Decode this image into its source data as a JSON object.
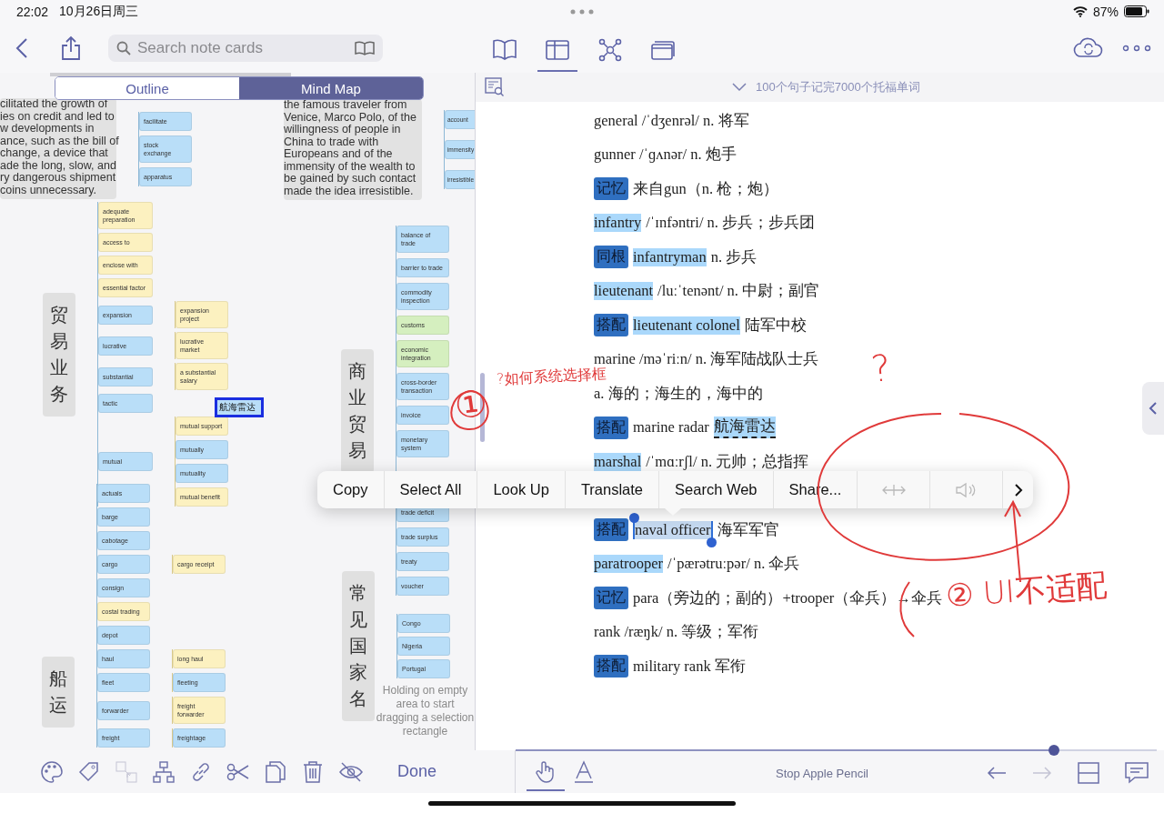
{
  "status_bar": {
    "time": "22:02",
    "date": "10月26日周三",
    "battery": "87%"
  },
  "toolbar": {
    "search": {
      "placeholder": "Search note cards"
    },
    "view_tabs": [
      {
        "kind": "book",
        "selected": false
      },
      {
        "kind": "panel",
        "selected": true
      },
      {
        "kind": "mindmap",
        "selected": false
      },
      {
        "kind": "cards",
        "selected": false
      }
    ]
  },
  "left_panel": {
    "segments": [
      {
        "label": "Outline",
        "selected": false
      },
      {
        "label": "Mind Map",
        "selected": true
      }
    ],
    "clusters": [
      {
        "kind": "note",
        "text": "cilitated the growth of\nies on credit and led to\nw developments in\nance, such as the bill of\nchange, a device that\nade the long, slow, and\nry dangerous shipment\ncoins unnecessary.",
        "children": [
          {
            "label": "facilitate",
            "color": "#b9def8"
          },
          {
            "label": "stock exchange",
            "color": "#b9def8"
          },
          {
            "label": "apparatus",
            "color": "#b9def8"
          }
        ]
      },
      {
        "kind": "topic",
        "title": "贸易业务",
        "children": [
          {
            "label": "adequate preparation",
            "color": "#fcf1c0"
          },
          {
            "label": "access to",
            "color": "#fcf1c0"
          },
          {
            "label": "enclose with",
            "color": "#fcf1c0"
          },
          {
            "label": "essential factor",
            "color": "#fcf1c0"
          },
          {
            "label": "expansion",
            "color": "#b9def8",
            "children": [
              {
                "label": "expansion project",
                "color": "#fcf1c0"
              }
            ]
          },
          {
            "label": "lucrative",
            "color": "#b9def8",
            "children": [
              {
                "label": "lucrative market",
                "color": "#fcf1c0"
              }
            ]
          },
          {
            "label": "substantial",
            "color": "#b9def8",
            "children": [
              {
                "label": "a substantial salary",
                "color": "#fcf1c0"
              }
            ]
          },
          {
            "label": "tactic",
            "color": "#b9def8"
          },
          {
            "label": "mutual",
            "color": "#b9def8",
            "children": [
              {
                "label": "mutual support",
                "color": "#fcf1c0"
              },
              {
                "label": "mutually",
                "color": "#b9def8"
              },
              {
                "label": "mutuality",
                "color": "#b9def8"
              },
              {
                "label": "mutual benefit",
                "color": "#fcf1c0"
              }
            ]
          }
        ]
      },
      {
        "kind": "topic",
        "title": "船运",
        "children": [
          {
            "label": "actuals",
            "color": "#b9def8"
          },
          {
            "label": "barge",
            "color": "#b9def8"
          },
          {
            "label": "cabotage",
            "color": "#b9def8"
          },
          {
            "label": "cargo",
            "color": "#b9def8",
            "children": [
              {
                "label": "cargo receipt",
                "color": "#fcf1c0"
              }
            ]
          },
          {
            "label": "consign",
            "color": "#b9def8"
          },
          {
            "label": "costal trading",
            "color": "#fcf1c0"
          },
          {
            "label": "depot",
            "color": "#b9def8"
          },
          {
            "label": "haul",
            "color": "#b9def8",
            "children": [
              {
                "label": "long haul",
                "color": "#fcf1c0"
              }
            ]
          },
          {
            "label": "fleet",
            "color": "#b9def8",
            "children": [
              {
                "label": "fleeting",
                "color": "#b9def8"
              }
            ]
          },
          {
            "label": "forwarder",
            "color": "#b9def8",
            "children": [
              {
                "label": "freight forwarder",
                "color": "#fcf1c0"
              }
            ]
          },
          {
            "label": "freight",
            "color": "#b9def8",
            "children": [
              {
                "label": "freightage",
                "color": "#b9def8"
              }
            ]
          }
        ]
      },
      {
        "kind": "note",
        "text": "the famous traveler from\nVenice, Marco Polo, of the\nwillingness of people in\nChina to trade with\nEuropeans and of the\nimmensity of the wealth to\nbe gained by such contact\nmade the idea irresistible.",
        "children": [
          {
            "label": "account",
            "color": "#b9def8"
          },
          {
            "label": "immensity",
            "color": "#b9def8"
          },
          {
            "label": "irresistible",
            "color": "#b9def8"
          }
        ]
      },
      {
        "kind": "topic",
        "title": "商业贸易",
        "children": [
          {
            "label": "balance of trade",
            "color": "#b9def8"
          },
          {
            "label": "barrier to trade",
            "color": "#b9def8"
          },
          {
            "label": "commodity inspection",
            "color": "#b9def8"
          },
          {
            "label": "customs",
            "color": "#d5efbf"
          },
          {
            "label": "economic integration",
            "color": "#d5efbf"
          },
          {
            "label": "cross-border transaction",
            "color": "#b9def8"
          },
          {
            "label": "invoice",
            "color": "#b9def8"
          },
          {
            "label": "monetary system",
            "color": "#b9def8"
          },
          {
            "label": "trade deficit",
            "color": "#b9def8"
          },
          {
            "label": "trade surplus",
            "color": "#b9def8"
          },
          {
            "label": "treaty",
            "color": "#b9def8"
          },
          {
            "label": "voucher",
            "color": "#b9def8"
          }
        ]
      },
      {
        "kind": "topic",
        "title": "常见国家名",
        "children": [
          {
            "label": "Congo",
            "color": "#b9def8"
          },
          {
            "label": "Nigeria",
            "color": "#b9def8"
          },
          {
            "label": "Portugal",
            "color": "#b9def8"
          }
        ]
      }
    ],
    "floating_node": {
      "label": "航海雷达",
      "selected": true
    },
    "hint": "Holding on empty area to start dragging a selection rectangle",
    "tools": [
      {
        "kind": "palette",
        "disabled": false
      },
      {
        "kind": "tag",
        "disabled": false
      },
      {
        "kind": "expand",
        "disabled": true
      },
      {
        "kind": "hierarchy",
        "disabled": false
      },
      {
        "kind": "link",
        "disabled": false
      },
      {
        "kind": "scissors",
        "disabled": false
      },
      {
        "kind": "copy",
        "disabled": false
      },
      {
        "kind": "trash",
        "disabled": false
      },
      {
        "kind": "hide",
        "disabled": false
      }
    ],
    "done": "Done"
  },
  "reader": {
    "title": "100个句子记完7000个托福单词",
    "lines": [
      {
        "parts": [
          {
            "text": "general /ˈdʒenrəl/ n. 将军",
            "kind": "plain"
          }
        ]
      },
      {
        "parts": [
          {
            "text": "gunner /ˈɡʌnər/ n. 炮手",
            "kind": "plain"
          }
        ]
      },
      {
        "tag": "记忆",
        "parts": [
          {
            "text": "来自gun（n. 枪；炮）",
            "kind": "plain"
          }
        ]
      },
      {
        "parts": [
          {
            "text": "infantry",
            "kind": "highlight"
          },
          {
            "text": "/ˈɪnfəntri/ n. 步兵；步兵团",
            "kind": "plain"
          }
        ]
      },
      {
        "tag": "同根",
        "parts": [
          {
            "text": "infantryman",
            "kind": "highlight"
          },
          {
            "text": "n. 步兵",
            "kind": "plain"
          }
        ]
      },
      {
        "parts": [
          {
            "text": "lieutenant",
            "kind": "highlight"
          },
          {
            "text": "/luːˈtenənt/ n. 中尉；副官",
            "kind": "plain"
          }
        ]
      },
      {
        "tag": "搭配",
        "parts": [
          {
            "text": "lieutenant colonel",
            "kind": "highlight"
          },
          {
            "text": "陆军中校",
            "kind": "plain"
          }
        ]
      },
      {
        "parts": [
          {
            "text": "marine /məˈriːn/ n. 海军陆战队士兵",
            "kind": "plain"
          }
        ]
      },
      {
        "parts": [
          {
            "text": "a. 海的；海生的，海中的",
            "kind": "plain"
          }
        ]
      },
      {
        "tag": "搭配",
        "parts": [
          {
            "text": "marine radar",
            "kind": "plain"
          },
          {
            "text": "航海雷达",
            "kind": "dashed"
          }
        ]
      },
      {
        "parts": [
          {
            "text": "marshal",
            "kind": "highlight"
          },
          {
            "text": "/ˈmɑːrʃl/ n. 元帅；总指挥",
            "kind": "plain"
          }
        ]
      },
      {
        "tag": "搭配",
        "parts": [
          {
            "text": "naval officer",
            "kind": "selection"
          },
          {
            "text": "海军军官",
            "kind": "plain"
          }
        ]
      },
      {
        "parts": [
          {
            "text": "paratrooper",
            "kind": "highlight"
          },
          {
            "text": "/ˈpærətruːpər/ n. 伞兵",
            "kind": "plain"
          }
        ]
      },
      {
        "tag": "记忆",
        "parts": [
          {
            "text": "para（旁边的；副的）+trooper（伞兵）→伞兵",
            "kind": "plain"
          }
        ]
      },
      {
        "parts": [
          {
            "text": "rank /ræŋk/ n. 等级；军衔",
            "kind": "plain"
          }
        ]
      },
      {
        "tag": "搭配",
        "parts": [
          {
            "text": "military rank 军衔",
            "kind": "plain"
          }
        ]
      }
    ],
    "context_menu": [
      {
        "kind": "text",
        "label": "Copy",
        "disabled": false
      },
      {
        "kind": "text",
        "label": "Select All",
        "disabled": false
      },
      {
        "kind": "text",
        "label": "Look Up",
        "disabled": false
      },
      {
        "kind": "text",
        "label": "Translate",
        "disabled": false
      },
      {
        "kind": "text",
        "label": "Search Web",
        "disabled": false
      },
      {
        "kind": "text",
        "label": "Share...",
        "disabled": false
      },
      {
        "kind": "arrows",
        "disabled": true
      },
      {
        "kind": "speaker",
        "disabled": true
      },
      {
        "kind": "more",
        "disabled": false
      }
    ],
    "progress": {
      "level": 0.84
    },
    "tools": [
      {
        "kind": "hand",
        "selected": true
      },
      {
        "kind": "pen",
        "selected": false
      }
    ],
    "pencil_button": "Stop Apple Pencil",
    "nav": [
      {
        "kind": "back",
        "disabled": false
      },
      {
        "kind": "forward",
        "disabled": true
      },
      {
        "kind": "layout",
        "disabled": false
      },
      {
        "kind": "comment",
        "disabled": false
      }
    ]
  },
  "handwriting": [
    {
      "text": "①"
    },
    {
      "text": "?如何系统选择框"
    },
    {
      "text": "?"
    },
    {
      "text": "② UI不适配"
    }
  ]
}
